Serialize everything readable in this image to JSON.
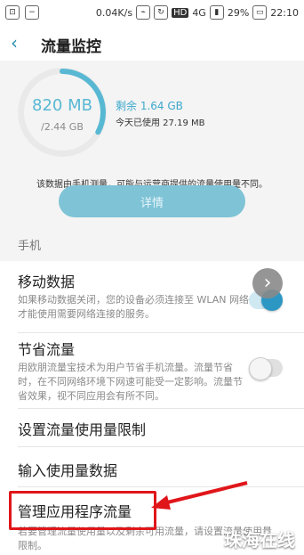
{
  "status_bar": {
    "left_text": "",
    "speed": "0.04K/s",
    "hd": "HD",
    "network": "4G",
    "battery": "29%",
    "time": "22:10"
  },
  "header": {
    "back_icon": "back-arrow-icon",
    "title": "流量监控"
  },
  "usage": {
    "used": "820 MB",
    "total": "/2.44 GB",
    "remaining": "剩余 1.64 GB",
    "today": "今天已使用 27.19 MB",
    "note": "该数据由手机测量，可能与运营商提供的流量使用量不同。",
    "details_button": "详情",
    "ring_fraction": 0.33
  },
  "section": {
    "title": "手机"
  },
  "items": [
    {
      "title": "移动数据",
      "desc": "如果移动数据关闭，您的设备必须连接至 WLAN 网络才能使用需要网络连接的服务。",
      "toggle": "on"
    },
    {
      "title": "节省流量",
      "desc": "用欧朋流量宝技术为用户节省手机流量。流量节省时，在不同网络环境下网速可能受一定影响。流量节省效果，视不同应用会有所不同。",
      "toggle": "off"
    },
    {
      "title": "设置流量使用量限制"
    },
    {
      "title": "输入使用量数据"
    },
    {
      "title": "管理应用程序流量",
      "desc": "若要管理流量使用量以及剩余可用流量，请设置流量使用量限制。"
    }
  ],
  "watermark": "珠海在线",
  "colors": {
    "accent": "#2d97c4",
    "highlight": "#e0161a"
  }
}
